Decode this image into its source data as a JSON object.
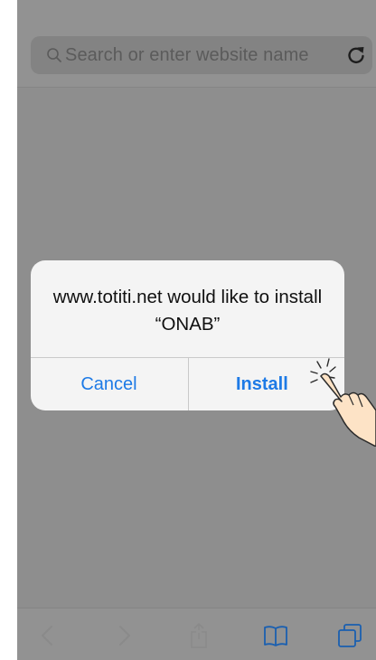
{
  "browser": {
    "search_placeholder": "Search or enter website name"
  },
  "dialog": {
    "message": "www.totiti.net would like to install “ONAB”",
    "cancel_label": "Cancel",
    "install_label": "Install"
  },
  "toolbar": {
    "buttons": [
      "back-icon",
      "forward-icon",
      "share-icon",
      "bookmarks-icon",
      "tabs-icon"
    ]
  },
  "colors": {
    "accent": "#1d7ae6",
    "dim_overlay": "#8e8e8e"
  }
}
